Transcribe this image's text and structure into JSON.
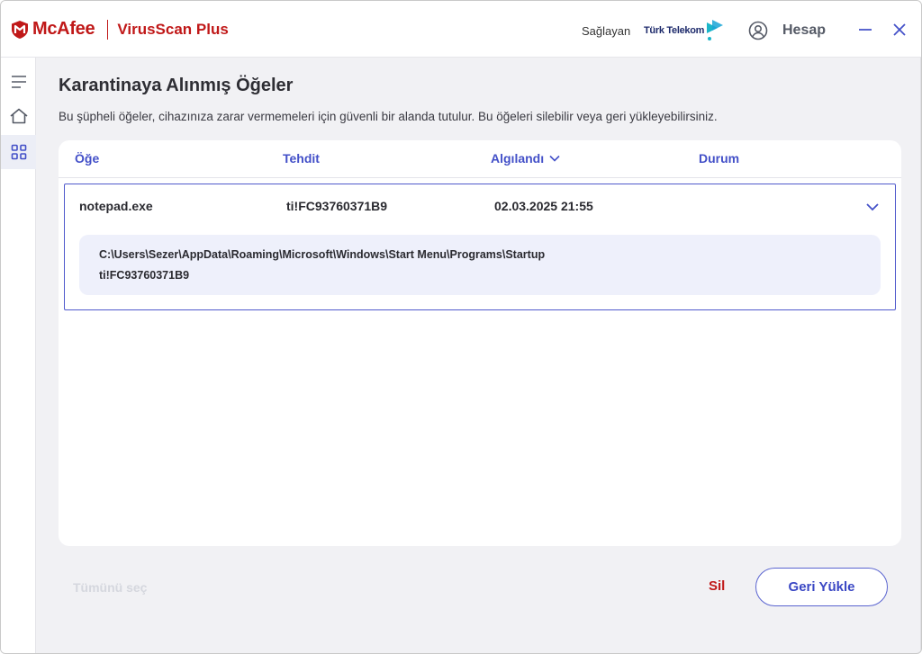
{
  "header": {
    "brand_name": "McAfee",
    "product_name": "VirusScan Plus",
    "provider_label": "Sağlayan",
    "provider_name": "Türk Telekom",
    "account_label": "Hesap"
  },
  "sidebar": {
    "items": [
      {
        "icon": "menu-icon"
      },
      {
        "icon": "home-icon"
      },
      {
        "icon": "grid-icon",
        "active": true
      }
    ]
  },
  "main": {
    "title": "Karantinaya Alınmış Öğeler",
    "description": "Bu şüpheli öğeler, cihazınıza zarar vermemeleri için güvenli bir alanda tutulur. Bu öğeleri silebilir veya geri yükleyebilirsiniz.",
    "columns": [
      "Öğe",
      "Tehdit",
      "Algılandı",
      "Durum"
    ],
    "rows": [
      {
        "item": "notepad.exe",
        "threat": "ti!FC93760371B9",
        "detected": "02.03.2025 21:55",
        "status": "",
        "detail_path": "C:\\Users\\Sezer\\AppData\\Roaming\\Microsoft\\Windows\\Start Menu\\Programs\\Startup",
        "detail_threat": "ti!FC93760371B9"
      }
    ]
  },
  "footer": {
    "select_all": "Tümünü seç",
    "delete": "Sil",
    "restore": "Geri Yükle"
  },
  "colors": {
    "brand_red": "#c01818",
    "accent_blue": "#4350c8"
  }
}
